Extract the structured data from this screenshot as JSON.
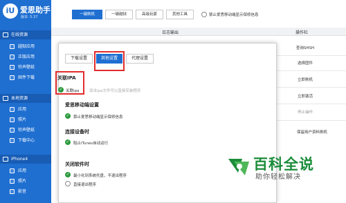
{
  "app": {
    "logo_text": "iU",
    "title": "爱思助手",
    "version": "版本: 5.37"
  },
  "sidebar": {
    "sections": [
      {
        "label": "在线资源",
        "items": [
          {
            "label": "越狱应用"
          },
          {
            "label": "正版应用"
          },
          {
            "label": "铃声壁纸"
          },
          {
            "label": "固件下载"
          }
        ]
      },
      {
        "label": "本地资源",
        "items": [
          {
            "label": "应用"
          },
          {
            "label": "照片"
          },
          {
            "label": "铃声壁纸"
          },
          {
            "label": "下载中心"
          }
        ]
      },
      {
        "label": "iPhone4",
        "items": [
          {
            "label": "应用"
          },
          {
            "label": "照片"
          },
          {
            "label": "影音"
          }
        ]
      }
    ]
  },
  "toolbar": {
    "buttons": [
      "一键刷机",
      "一键越狱",
      "高级玩家",
      "其他工具"
    ],
    "checkbox_label": "禁止爱思移动端显示保修信息"
  },
  "log": {
    "header": "日志输出",
    "ops_header": "操作栏"
  },
  "ops": [
    "查询SHSH",
    "选择固件",
    "立即刷机",
    "立即激活",
    "停止操作",
    "保留用户资料刷机"
  ],
  "dialog": {
    "tabs": [
      "下载设置",
      "其他设置",
      "代理设置"
    ],
    "sections": [
      {
        "title": "关联IPA",
        "option": "关联ipa",
        "note": "双击ipa文件可以直接安装程序"
      },
      {
        "title": "爱思移动端设置",
        "option": "禁止爱思移动端显示保修信息"
      },
      {
        "title": "连接设备时",
        "option": "阻止iTunes自动运行"
      },
      {
        "title": "关闭软件时",
        "options": [
          "最小化到系统托盘，不退出程序",
          "直接退出程序"
        ]
      }
    ]
  },
  "watermark": {
    "title": "百科全说",
    "subtitle": "助你轻松解决"
  },
  "colors": {
    "brand": "#1f6fd1",
    "highlight": "#e22b2b",
    "check": "#2d9a3f"
  }
}
